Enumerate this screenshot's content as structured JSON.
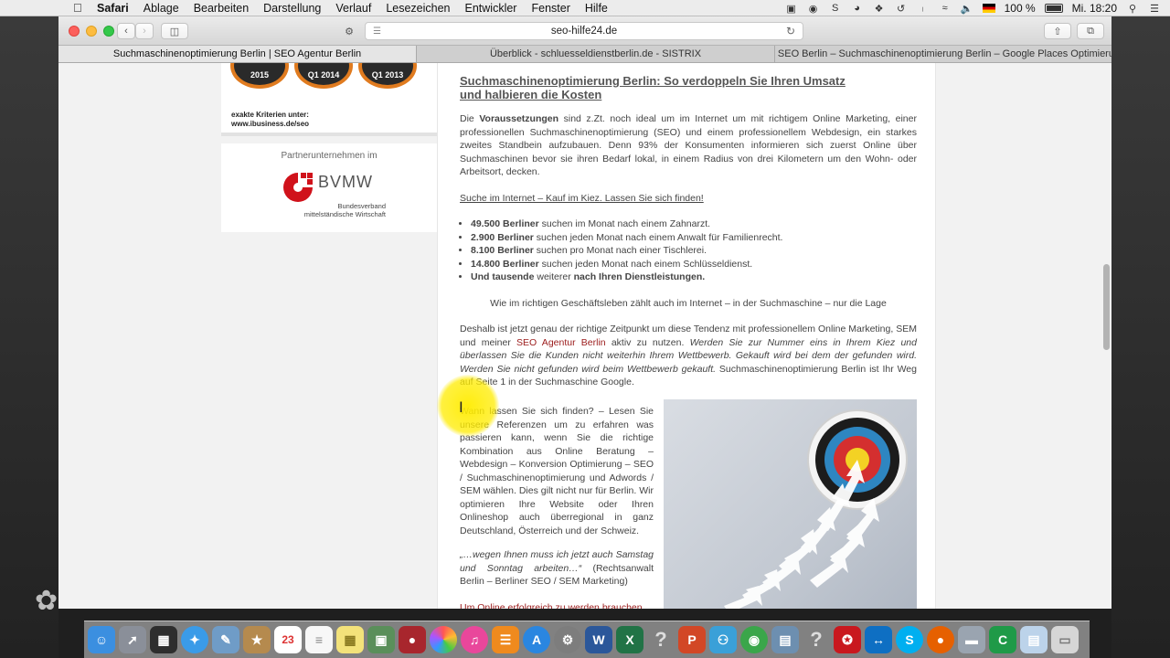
{
  "menubar": {
    "app": "Safari",
    "items": [
      "Ablage",
      "Bearbeiten",
      "Darstellung",
      "Verlauf",
      "Lesezeichen",
      "Entwickler",
      "Fenster",
      "Hilfe"
    ],
    "battery": "100 %",
    "clock": "Mi. 18:20"
  },
  "browser": {
    "url": "seo-hilfe24.de",
    "tabs": [
      "Suchmaschinenoptimierung Berlin | SEO Agentur Berlin",
      "Überblick - schluesseldienstberlin.de - SISTRIX",
      "SEO Berlin – Suchmaschinenoptimierung Berlin – Google Places Optimierun…"
    ],
    "add_tab": "+"
  },
  "sidebar": {
    "badges": [
      "2015",
      "Q1 2014",
      "Q1 2013"
    ],
    "criteria_line1": "exakte Kriterien unter:",
    "criteria_line2": "www.ibusiness.de/seo",
    "partner_label": "Partnerunternehmen im",
    "bvmw_name": "BVMW",
    "bvmw_sub1": "Bundesverband",
    "bvmw_sub2": "mittelständische Wirtschaft"
  },
  "article": {
    "title_line1": "Suchmaschinenoptimierung Berlin: So verdoppeln Sie Ihren Umsatz",
    "title_line2": "und halbieren die Kosten",
    "intro_a": "Die ",
    "intro_bold": "Voraussetzungen",
    "intro_b": " sind z.Zt. noch ideal um im Internet um mit richtigem Online Marketing, einer professionellen Suchmaschinenoptimierung (SEO) und einem professionellem Webdesign, ein starkes zweites Standbein aufzubauen. Denn 93% der Konsumenten informieren sich zuerst Online über Suchmaschinen bevor sie ihren Bedarf lokal, in einem Radius von drei Kilometern um den Wohn- oder Arbeitsort, decken.",
    "subheading": "Suche im Internet – Kauf im Kiez. Lassen Sie sich finden!",
    "bullets": [
      {
        "bold": "49.500 Berliner",
        "text": " suchen im Monat nach einem Zahnarzt."
      },
      {
        "bold": "2.900 Berliner",
        "text": " suchen jeden Monat nach einem Anwalt für Familienrecht."
      },
      {
        "bold": "8.100 Berliner",
        "text": " suchen pro Monat nach einer Tischlerei."
      },
      {
        "bold": "14.800 Berliner",
        "text": " suchen jeden Monat nach einem Schlüsseldienst."
      }
    ],
    "last_bullet_a": "Und tausende",
    "last_bullet_b": " weiterer ",
    "last_bullet_c": "nach Ihren Dienstleistungen.",
    "center_line": "Wie im richtigen Geschäftsleben zählt auch im Internet – in der Suchmaschine – nur die Lage",
    "para2_a": "Deshalb ist jetzt genau der richtige Zeitpunkt um diese Tendenz mit professionellem Online Marketing, SEM und meiner ",
    "para2_link": "SEO Agentur Berlin",
    "para2_b": " aktiv zu nutzen. ",
    "para2_italic": "Werden Sie zur Nummer eins in Ihrem Kiez und überlassen Sie die Kunden nicht weiterhin Ihrem Wettbewerb. Gekauft wird bei dem der gefunden wird. Werden Sie nicht gefunden wird beim Wettbewerb gekauft.",
    "para2_c": " Suchmaschinenoptimierung Berlin ist Ihr Weg auf Seite 1 in der Suchmaschine Google.",
    "col_text": "Wann lassen Sie sich finden? – Lesen Sie unsere Referenzen um zu erfahren was passieren kann, wenn Sie die richtige Kombination aus Online Beratung – Webdesign – Konversion Optimierung – SEO / Suchmaschinenoptimierung und Adwords / SEM wählen. Dies gilt nicht nur für Berlin. Wir optimieren Ihre Website oder Ihren Onlineshop auch überregional in ganz Deutschland, Österreich und der Schweiz.",
    "quote_italic": "„…wegen Ihnen muss ich jetzt auch Samstag und Sonntag arbeiten…“",
    "quote_source": " (Rechtsanwalt Berlin – Berliner SEO / SEM Marketing)",
    "cta": "Um Online erfolgreich zu werden brauchen"
  },
  "dock": {
    "icons": [
      "finder-icon",
      "launchpad-icon",
      "mission-control-icon",
      "safari-icon",
      "preview-icon",
      "notes-app-icon",
      "calendar-icon",
      "reminders-icon",
      "stickies-icon",
      "image-capture-icon",
      "photo-booth-icon",
      "photos-icon",
      "itunes-icon",
      "ibooks-icon",
      "app-store-icon",
      "system-prefs-icon",
      "word-icon",
      "excel-icon",
      "help-icon",
      "powerpoint-icon",
      "network-icon",
      "network-utility-icon",
      "archive-icon",
      "help-icon-2",
      "acrobat-icon",
      "teamviewer-icon",
      "skype-icon",
      "firefox-icon",
      "disk-icon",
      "camtasia-icon",
      "folder-icon",
      "trash-icon"
    ],
    "calendar_day": "23"
  }
}
